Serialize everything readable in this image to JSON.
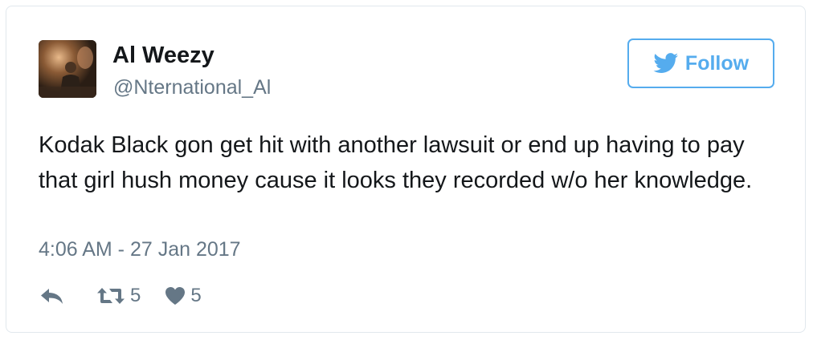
{
  "user": {
    "display_name": "Al Weezy",
    "handle": "@Nternational_Al"
  },
  "follow_button": {
    "label": "Follow"
  },
  "tweet": {
    "text": "Kodak Black gon get hit with another lawsuit or end up having to pay that girl hush money cause it looks they recorded w/o her knowledge.",
    "timestamp": "4:06 AM - 27 Jan 2017"
  },
  "actions": {
    "reply_icon": "reply-icon",
    "retweet_icon": "retweet-icon",
    "retweet_count": "5",
    "like_icon": "heart-icon",
    "like_count": "5"
  },
  "colors": {
    "accent": "#55acee",
    "text_primary": "#14171a",
    "text_secondary": "#657786",
    "border": "#e1e8ed"
  }
}
